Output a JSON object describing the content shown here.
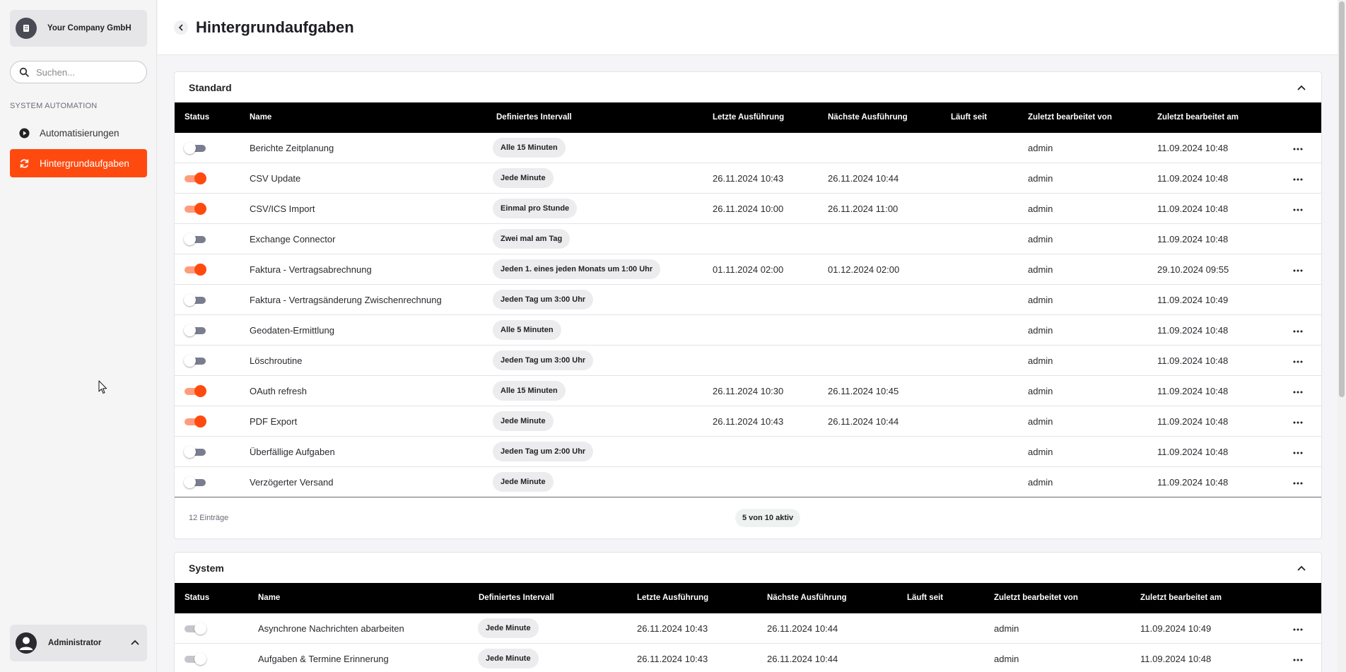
{
  "sidebar": {
    "company": "Your Company GmbH",
    "search_placeholder": "Suchen...",
    "section": "SYSTEM AUTOMATION",
    "items": [
      {
        "label": "Automatisierungen",
        "icon": "play-circle-icon"
      },
      {
        "label": "Hintergrundaufgaben",
        "icon": "refresh-icon"
      }
    ],
    "user": "Administrator"
  },
  "header": {
    "title": "Hintergrundaufgaben"
  },
  "colors": {
    "accent": "#ff4a0f",
    "toggle_on_track": "#ff9c7d",
    "toggle_off_track": "#7a7d8f",
    "table_header": "#000000"
  },
  "columns": [
    "Status",
    "Name",
    "Definiertes Intervall",
    "Letzte Ausführung",
    "Nächste Ausführung",
    "Läuft seit",
    "Zuletzt bearbeitet von",
    "Zuletzt bearbeitet am"
  ],
  "standard": {
    "title": "Standard",
    "rows": [
      {
        "active": false,
        "name": "Berichte Zeitplanung",
        "interval": "Alle 15 Minuten",
        "last": "",
        "next": "",
        "running": "",
        "by": "admin",
        "at": "11.09.2024 10:48",
        "menu": true
      },
      {
        "active": true,
        "name": "CSV Update",
        "interval": "Jede Minute",
        "last": "26.11.2024 10:43",
        "next": "26.11.2024 10:44",
        "running": "",
        "by": "admin",
        "at": "11.09.2024 10:48",
        "menu": true
      },
      {
        "active": true,
        "name": "CSV/ICS Import",
        "interval": "Einmal pro Stunde",
        "last": "26.11.2024 10:00",
        "next": "26.11.2024 11:00",
        "running": "",
        "by": "admin",
        "at": "11.09.2024 10:48",
        "menu": true
      },
      {
        "active": false,
        "name": "Exchange Connector",
        "interval": "Zwei mal am Tag",
        "last": "",
        "next": "",
        "running": "",
        "by": "admin",
        "at": "11.09.2024 10:48",
        "menu": false
      },
      {
        "active": true,
        "name": "Faktura - Vertragsabrechnung",
        "interval": "Jeden 1. eines jeden Monats um 1:00 Uhr",
        "last": "01.11.2024 02:00",
        "next": "01.12.2024 02:00",
        "running": "",
        "by": "admin",
        "at": "29.10.2024 09:55",
        "menu": true
      },
      {
        "active": false,
        "name": "Faktura - Vertragsänderung Zwischenrechnung",
        "interval": "Jeden Tag um 3:00 Uhr",
        "last": "",
        "next": "",
        "running": "",
        "by": "admin",
        "at": "11.09.2024 10:49",
        "menu": false
      },
      {
        "active": false,
        "name": "Geodaten-Ermittlung",
        "interval": "Alle 5 Minuten",
        "last": "",
        "next": "",
        "running": "",
        "by": "admin",
        "at": "11.09.2024 10:48",
        "menu": true
      },
      {
        "active": false,
        "name": "Löschroutine",
        "interval": "Jeden Tag um 3:00 Uhr",
        "last": "",
        "next": "",
        "running": "",
        "by": "admin",
        "at": "11.09.2024 10:48",
        "menu": true
      },
      {
        "active": true,
        "name": "OAuth refresh",
        "interval": "Alle 15 Minuten",
        "last": "26.11.2024 10:30",
        "next": "26.11.2024 10:45",
        "running": "",
        "by": "admin",
        "at": "11.09.2024 10:48",
        "menu": true
      },
      {
        "active": true,
        "name": "PDF Export",
        "interval": "Jede Minute",
        "last": "26.11.2024 10:43",
        "next": "26.11.2024 10:44",
        "running": "",
        "by": "admin",
        "at": "11.09.2024 10:48",
        "menu": true
      },
      {
        "active": false,
        "name": "Überfällige Aufgaben",
        "interval": "Jeden Tag um 2:00 Uhr",
        "last": "",
        "next": "",
        "running": "",
        "by": "admin",
        "at": "11.09.2024 10:48",
        "menu": true
      },
      {
        "active": false,
        "name": "Verzögerter Versand",
        "interval": "Jede Minute",
        "last": "",
        "next": "",
        "running": "",
        "by": "admin",
        "at": "11.09.2024 10:48",
        "menu": true
      }
    ],
    "entries": "12 Einträge",
    "active_summary": "5 von 10 aktiv"
  },
  "system": {
    "title": "System",
    "rows": [
      {
        "active": true,
        "name": "Asynchrone Nachrichten abarbeiten",
        "interval": "Jede Minute",
        "last": "26.11.2024 10:43",
        "next": "26.11.2024 10:44",
        "running": "",
        "by": "admin",
        "at": "11.09.2024 10:49",
        "menu": true
      },
      {
        "active": true,
        "name": "Aufgaben & Termine Erinnerung",
        "interval": "Jede Minute",
        "last": "26.11.2024 10:43",
        "next": "26.11.2024 10:44",
        "running": "",
        "by": "admin",
        "at": "11.09.2024 10:48",
        "menu": true
      }
    ]
  }
}
